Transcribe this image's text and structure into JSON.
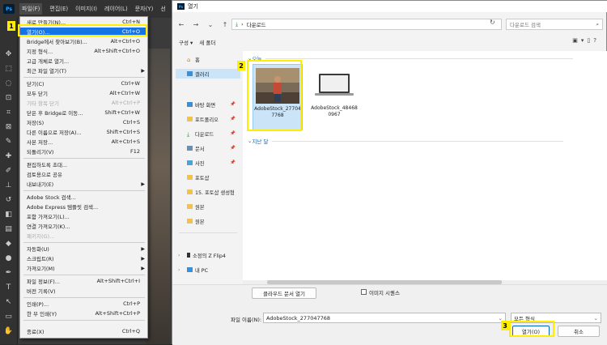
{
  "ps": {
    "logo": "Ps",
    "menu": [
      "파일(F)",
      "편집(E)",
      "이미지(I)",
      "레이어(L)",
      "문자(Y)",
      "선"
    ]
  },
  "file_menu": {
    "items": [
      {
        "label": "새로 만들기(N)...",
        "shortcut": "Ctrl+N"
      },
      {
        "label": "열기(O)...",
        "shortcut": "Ctrl+O"
      },
      {
        "label": "Bridge에서 찾아보기(B)...",
        "shortcut": "Alt+Ctrl+O"
      },
      {
        "label": "지정 형식...",
        "shortcut": "Alt+Shift+Ctrl+O"
      },
      {
        "label": "고급 개체로 열기...",
        "shortcut": ""
      },
      {
        "label": "최근 파일 열기(T)",
        "shortcut": ""
      },
      {
        "label": "닫기(C)",
        "shortcut": "Ctrl+W"
      },
      {
        "label": "모두 닫기",
        "shortcut": "Alt+Ctrl+W"
      },
      {
        "label": "기타 항목 닫기",
        "shortcut": "Alt+Ctrl+P"
      },
      {
        "label": "닫은 후 Bridge로 이동...",
        "shortcut": "Shift+Ctrl+W"
      },
      {
        "label": "저장(S)",
        "shortcut": "Ctrl+S"
      },
      {
        "label": "다른 이름으로 저장(A)...",
        "shortcut": "Shift+Ctrl+S"
      },
      {
        "label": "사본 저장...",
        "shortcut": "Alt+Ctrl+S"
      },
      {
        "label": "되돌리기(V)",
        "shortcut": "F12"
      },
      {
        "label": "편집하도록 초대...",
        "shortcut": ""
      },
      {
        "label": "검토용으로 공유",
        "shortcut": ""
      },
      {
        "label": "내보내기(E)",
        "shortcut": ""
      },
      {
        "label": "Adobe Stock 검색...",
        "shortcut": ""
      },
      {
        "label": "Adobe Express 템플릿 검색...",
        "shortcut": ""
      },
      {
        "label": "포함 가져오기(L)...",
        "shortcut": ""
      },
      {
        "label": "연결 가져오기(K)...",
        "shortcut": ""
      },
      {
        "label": "패키지(G)...",
        "shortcut": ""
      },
      {
        "label": "자동화(U)",
        "shortcut": ""
      },
      {
        "label": "스크립트(R)",
        "shortcut": ""
      },
      {
        "label": "가져오기(M)",
        "shortcut": ""
      },
      {
        "label": "파일 정보(F)...",
        "shortcut": "Alt+Shift+Ctrl+I"
      },
      {
        "label": "버전 기록(V)",
        "shortcut": ""
      },
      {
        "label": "인쇄(P)...",
        "shortcut": "Ctrl+P"
      },
      {
        "label": "한 부 인쇄(Y)",
        "shortcut": "Alt+Shift+Ctrl+P"
      },
      {
        "label": "종료(X)",
        "shortcut": "Ctrl+Q"
      }
    ]
  },
  "badges": {
    "one": "1",
    "two": "2",
    "three": "3"
  },
  "dialog": {
    "title": "열기",
    "ps_icon": "Ps",
    "address": "다운로드",
    "search_placeholder": "다운로드 검색",
    "cmd_organize": "구성 ▾",
    "cmd_new_folder": "새 폴더",
    "nav": {
      "home": "홈",
      "gallery": "갤러리",
      "desktop": "바탕 화면",
      "portfolio": "포트폴리오",
      "downloads": "다운로드",
      "documents": "문서",
      "pictures": "사진",
      "photoshop": "포토샵",
      "folder15": "15. 포토샵 생성형",
      "original1": "원본",
      "original2": "원본",
      "phone": "소정의 Z Flip4",
      "pc": "내 PC"
    },
    "groups": {
      "today": "오늘",
      "last_month": "지난 달"
    },
    "files": [
      {
        "name": "AdobeStock_277047768"
      },
      {
        "name": "AdobeStock_484680967"
      }
    ],
    "cloud_btn": "클라우드 문서 열기",
    "image_sequence": "이미지 시퀀스",
    "filename_label": "파일 이름(N):",
    "filename_value": "AdobeStock_277047768",
    "filetype_value": "모든 형식",
    "open_btn": "열기(O)",
    "cancel_btn": "취소"
  }
}
